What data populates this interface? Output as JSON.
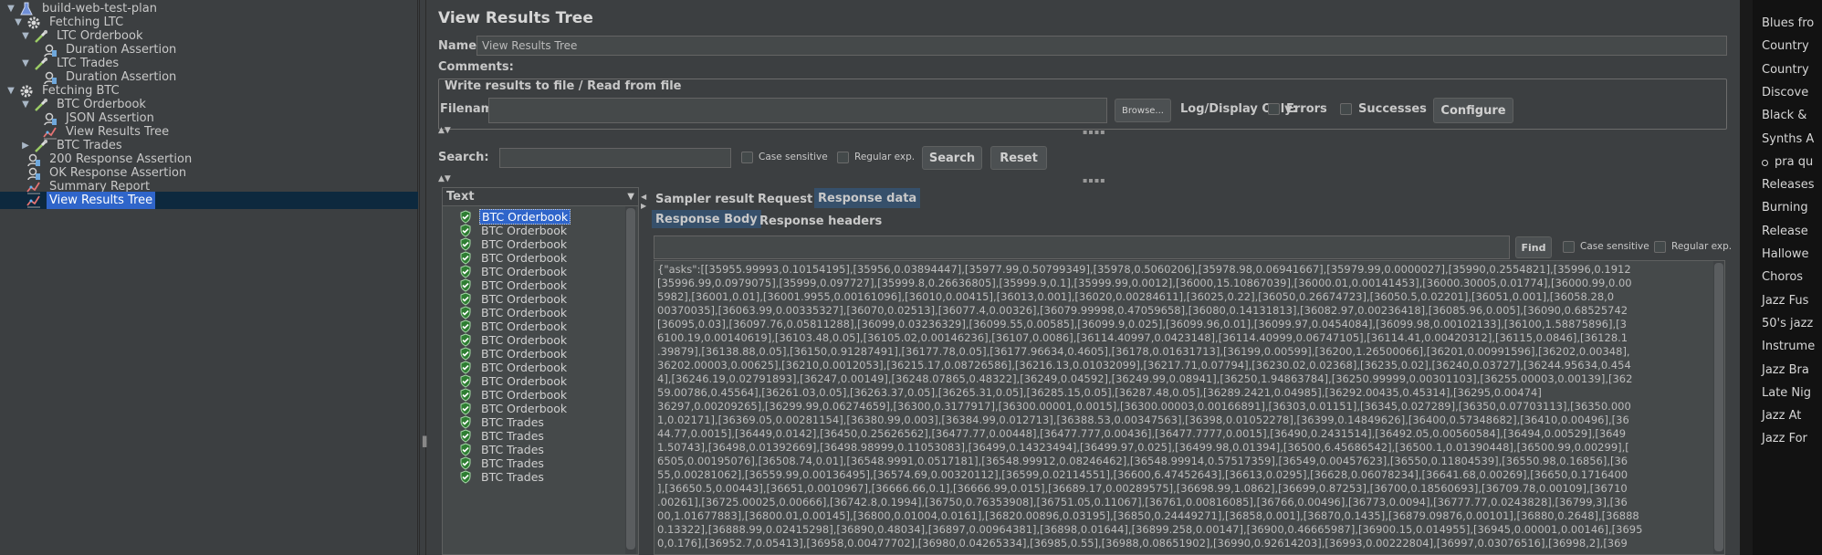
{
  "tree": {
    "items": [
      {
        "label": "build-web-test-plan",
        "icon": "flask-icon",
        "arrow": "▼"
      },
      {
        "label": "Fetching LTC",
        "icon": "gear-icon",
        "arrow": "▼"
      },
      {
        "label": "LTC Orderbook",
        "icon": "pipette-icon",
        "arrow": "▼"
      },
      {
        "label": "Duration Assertion",
        "icon": "assertion-icon",
        "arrow": ""
      },
      {
        "label": "LTC Trades",
        "icon": "pipette-icon",
        "arrow": "▼"
      },
      {
        "label": "Duration Assertion",
        "icon": "assertion-icon",
        "arrow": ""
      },
      {
        "label": "Fetching BTC",
        "icon": "gear-icon",
        "arrow": "▼"
      },
      {
        "label": "BTC Orderbook",
        "icon": "pipette-icon",
        "arrow": "▼"
      },
      {
        "label": "JSON Assertion",
        "icon": "assertion-icon",
        "arrow": ""
      },
      {
        "label": "View Results Tree",
        "icon": "chart-icon",
        "arrow": ""
      },
      {
        "label": "BTC Trades",
        "icon": "pipette-icon",
        "arrow": "▶"
      },
      {
        "label": "200 Response Assertion",
        "icon": "assertion-icon",
        "arrow": ""
      },
      {
        "label": "OK  Response Assertion",
        "icon": "assertion-icon",
        "arrow": ""
      },
      {
        "label": "Summary Report",
        "icon": "chart-icon",
        "arrow": ""
      },
      {
        "label": "View Results Tree",
        "icon": "chart-icon",
        "arrow": ""
      }
    ]
  },
  "panel": {
    "title": "View Results Tree",
    "name_label": "Name:",
    "name_value": "View Results Tree",
    "comments_label": "Comments:",
    "write_results_title": "Write results to file / Read from file",
    "filename_label": "Filename",
    "browse_label": "Browse...",
    "log_display_label": "Log/Display Only:",
    "errors_label": "Errors",
    "successes_label": "Successes",
    "configure_label": "Configure",
    "search_label": "Search:",
    "case_sensitive_label": "Case sensitive",
    "regular_exp_label": "Regular exp.",
    "search_button": "Search",
    "reset_button": "Reset"
  },
  "samples": {
    "header": "Text",
    "items": [
      "BTC Orderbook",
      "BTC Orderbook",
      "BTC Orderbook",
      "BTC Orderbook",
      "BTC Orderbook",
      "BTC Orderbook",
      "BTC Orderbook",
      "BTC Orderbook",
      "BTC Orderbook",
      "BTC Orderbook",
      "BTC Orderbook",
      "BTC Orderbook",
      "BTC Orderbook",
      "BTC Orderbook",
      "BTC Orderbook",
      "BTC Trades",
      "BTC Trades",
      "BTC Trades",
      "BTC Trades",
      "BTC Trades"
    ]
  },
  "result_tabs": {
    "sampler_result": "Sampler result",
    "request": "Request",
    "response_data": "Response data",
    "response_body": "Response Body",
    "response_headers": "Response headers",
    "find_button": "Find",
    "case_sensitive_label": "Case sensitive",
    "regular_exp_label": "Regular exp."
  },
  "response_lines": [
    "{\"asks\":[[35955.99993,0.10154195],[35956,0.03894447],[35977.99,0.50799349],[35978,0.5060206],[35978.98,0.06941667],[35979.99,0.0000027],[35990,0.2554821],[35996,0.1912",
    "[35996.99,0.0979075],[35999,0.097727],[35999.8,0.26636805],[35999.9,0.1],[35999.99,0.0012],[36000,15.10867039],[36000.01,0.00141453],[36000.30005,0.01774],[36000.99,0.00",
    "5982],[36001,0.01],[36001.9955,0.00161096],[36010,0.00415],[36013,0.001],[36020,0.00284611],[36025,0.22],[36050,0.26674723],[36050.5,0.02201],[36051,0.001],[36058.28,0",
    "00370035],[36063.99,0.00335327],[36070,0.02513],[36077.4,0.00326],[36079.99998,0.47059658],[36080,0.14131813],[36082.97,0.00236418],[36085.96,0.005],[36090,0.68525742",
    "[36095,0.03],[36097.76,0.05811288],[36099,0.03236329],[36099.55,0.00585],[36099.9,0.025],[36099.96,0.01],[36099.97,0.0454084],[36099.98,0.00102133],[36100,1.58875896],[3",
    "6100.19,0.00140619],[36103.48,0.05],[36105.02,0.00146236],[36107,0.0086],[36114.40997,0.0423148],[36114.40999,0.06747105],[36114.41,0.00420312],[36115,0.0846],[36128.1",
    ".39879],[36138.88,0.05],[36150,0.91287491],[36177.78,0.05],[36177.96634,0.4605],[36178,0.01631713],[36199,0.00599],[36200,1.26500066],[36201,0.00991596],[36202,0.00348],",
    "36202.00003,0.00625],[36210,0.0012053],[36215.17,0.08726586],[36216.13,0.01032099],[36217.71,0.07794],[36230.02,0.02368],[36235,0.02],[36240,0.03727],[36244.95634,0.454",
    "4],[36246.19,0.02791893],[36247,0.00149],[36248.07865,0.48322],[36249,0.04592],[36249.99,0.08941],[36250,1.94863784],[36250.99999,0.00301103],[36255.00003,0.00139],[362",
    "59.00786,0.45564],[36261.03,0.05],[36263.37,0.05],[36265.31,0.05],[36285.15,0.05],[36287.48,0.05],[36289.2421,0.04985],[36292.00435,0.45314],[36295,0.00474]",
    "36297,0.00209265],[36299.99,0.06274659],[36300,0.3177917],[36300.00001,0.0015],[36300.00003,0.00166891],[36303,0.01151],[36345,0.027289],[36350,0.07703113],[36350.000",
    "1,0.02171],[36369.05,0.00281154],[36380.99,0.003],[36384.99,0.012713],[36388.53,0.00347563],[36398,0.01052278],[36399,0.14849626],[36400,0.57348682],[36410,0.00496],[36",
    "44.77,0.0015],[36449,0.0142],[36450,0.25626562],[36477.77,0.00448],[36477.777,0.00436],[36477.7777,0.0015],[36490,0.2431514],[36492.05,0.00560584],[36494,0.00529],[3649",
    "1.50743],[36498,0.01392669],[36498.98999,0.11053083],[36499,0.14323494],[36499.97,0.025],[36499.98,0.01394],[36500,6.45686542],[36500.1,0.01390448],[36500.99,0.00299],[",
    "6505,0.00195076],[36508.74,0.01],[36548.9991,0.0517181],[36548.99912,0.08246462],[36548.99914,0.57517359],[36549,0.00457623],[36550,0.11804539],[36550.98,0.16856],[36",
    "55,0.00281062],[36559.99,0.00136495],[36574.69,0.00320112],[36599,0.02114551],[36600,6.47452643],[36613,0.0295],[36628,0.06078234],[36641.68,0.00269],[36650,0.1716400",
    "],[36650.5,0.00443],[36651,0.0010967],[36666.66,0.1],[36666.99,0.015],[36689.17,0.00289575],[36698.99,1.0862],[36699,0.87253],[36700,0.18560693],[36709.78,0.00109],[36710",
    ".00261],[36725.00025,0.00666],[36742.8,0.1994],[36750,0.76353908],[36751.05,0.11067],[36761,0.00816085],[36766,0.00496],[36773,0.0094],[36777.77,0.0243828],[36799,3],[36",
    "00,1.01677883],[36800.01,0.00145],[36800,0.01004,0.0161],[36820.00896,0.03195],[36850,0.24449271],[36858,0.001],[36870,0.1435],[36879.09876,0.00101],[36880,0.2648],[36888",
    "0.13322],[36888.99,0.02415298],[36890,0.48034],[36897,0.00964381],[36898,0.01644],[36899.258,0.00147],[36900,0.46665987],[36900.15,0.014955],[36945,0.00001,0.00146],[3695",
    "0,0.176],[36952.7,0.05413],[36958,0.00477702],[36980,0.04265334],[36985,0.55],[36988,0.08651902],[36990,0.92614203],[36993,0.00222804],[36997,0.03076516],[36998,2],[369"
  ],
  "side_panel": {
    "items": [
      "Blues fro",
      "Country",
      "Country",
      "Discove",
      "Black &",
      "Synths A",
      "pra qu",
      "Releases",
      "Burning",
      "Release",
      "Hallowe",
      "Choros",
      "Jazz Fus",
      "50's jazz",
      "Instrume",
      "Jazz Bra",
      "Late Nig",
      "Jazz At",
      "Jazz For"
    ]
  }
}
